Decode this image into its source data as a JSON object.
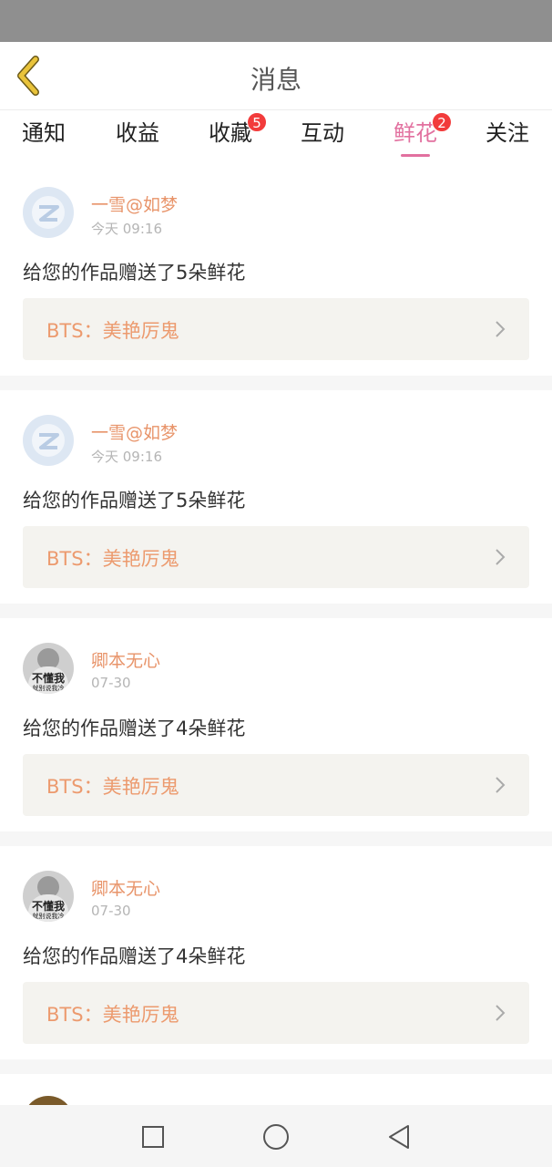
{
  "header": {
    "title": "消息"
  },
  "tabs": [
    {
      "label": "通知",
      "badge": ""
    },
    {
      "label": "收益",
      "badge": ""
    },
    {
      "label": "收藏",
      "badge": "5"
    },
    {
      "label": "互动",
      "badge": ""
    },
    {
      "label": "鲜花",
      "badge": "2",
      "active": true
    },
    {
      "label": "关注",
      "badge": ""
    }
  ],
  "messages": [
    {
      "user": "一雪@如梦",
      "time": "今天 09:16",
      "text": "给您的作品赠送了5朵鲜花",
      "work": "BTS：美艳厉鬼",
      "avatar": "default"
    },
    {
      "user": "一雪@如梦",
      "time": "今天 09:16",
      "text": "给您的作品赠送了5朵鲜花",
      "work": "BTS：美艳厉鬼",
      "avatar": "default"
    },
    {
      "user": "卿本无心",
      "time": "07-30",
      "text": "给您的作品赠送了4朵鲜花",
      "work": "BTS：美艳厉鬼",
      "avatar": "photo",
      "avatar_text": "不懂我",
      "avatar_subtext": "就别说我冷"
    },
    {
      "user": "卿本无心",
      "time": "07-30",
      "text": "给您的作品赠送了4朵鲜花",
      "work": "BTS：美艳厉鬼",
      "avatar": "photo",
      "avatar_text": "不懂我",
      "avatar_subtext": "就别说我冷"
    }
  ],
  "colors": {
    "accent_pink": "#e2709f",
    "badge_red": "#f23b3b",
    "name_orange": "#e8946a",
    "work_orange": "#ec9a6e",
    "back_arrow_yellow": "#e9c33a"
  },
  "icons": {
    "back": "back-arrow-icon",
    "chevron": "chevron-right-icon",
    "nav_recent": "square-icon",
    "nav_home": "circle-icon",
    "nav_back": "triangle-back-icon"
  }
}
